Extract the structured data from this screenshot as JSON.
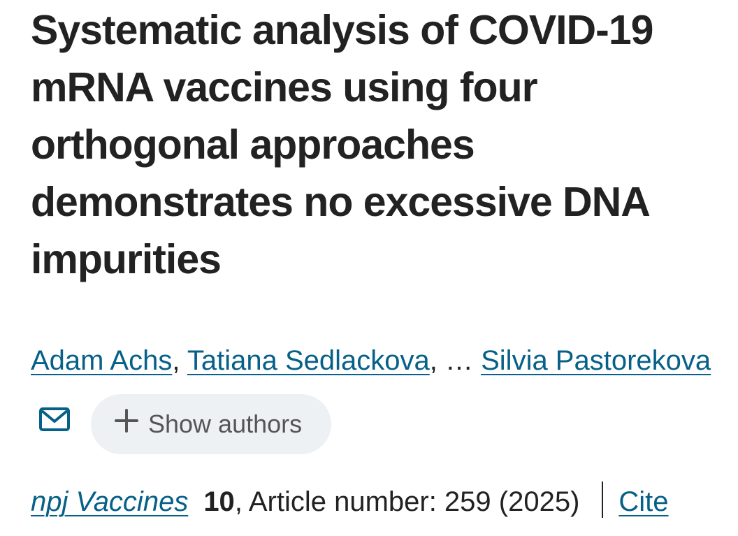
{
  "article": {
    "title": "Systematic analysis of COVID-19 mRNA vaccines using four orthogonal approaches demonstrates no excessive DNA impurities",
    "authors": {
      "first": "Adam Achs",
      "second": "Tatiana Sedlackova",
      "separator": ",",
      "ellipsis": " … ",
      "last": "Silvia Pastorekova",
      "show_authors_label": "Show authors",
      "mail_icon": "envelope-icon",
      "plus_icon": "plus-icon"
    },
    "citation": {
      "journal": "npj Vaccines",
      "volume": "10",
      "details": ", Article number: 259 (2025)",
      "cite_label": "Cite"
    }
  },
  "colors": {
    "link": "#066088",
    "text": "#222222",
    "pill_background": "#eef1f4",
    "pill_text": "#555555"
  }
}
